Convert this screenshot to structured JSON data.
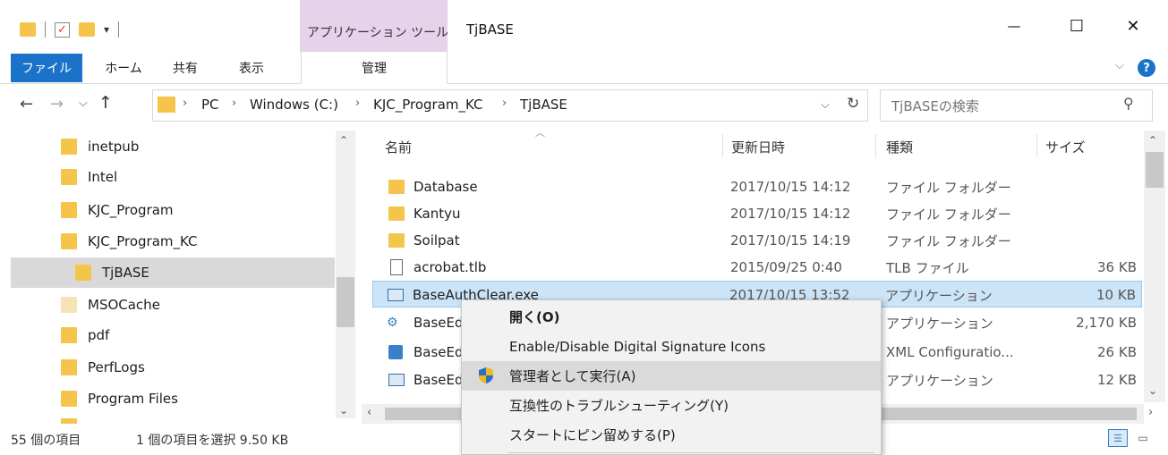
{
  "titlebar": {
    "context_tab_label": "アプリケーション ツール",
    "window_title": "TjBASE",
    "minimize_label": "—",
    "maximize_label": "☐",
    "close_label": "✕"
  },
  "ribbon": {
    "tabs": [
      "ファイル",
      "ホーム",
      "共有",
      "表示",
      "管理"
    ],
    "expand_label": "⌵",
    "help_label": "?"
  },
  "address": {
    "back_label": "←",
    "forward_label": "→",
    "recent_label": "⌵",
    "up_label": "↑",
    "path": [
      "PC",
      "Windows (C:)",
      "KJC_Program_KC",
      "TjBASE"
    ],
    "dropdown_label": "⌵",
    "refresh_label": "↻",
    "search_placeholder": "TjBASEの検索",
    "search_icon_label": "⚲"
  },
  "nav": {
    "items": [
      {
        "label": "inetpub",
        "faded": false
      },
      {
        "label": "Intel",
        "faded": false
      },
      {
        "label": "KJC_Program",
        "faded": false
      },
      {
        "label": "KJC_Program_KC",
        "faded": false
      },
      {
        "label": "TjBASE",
        "faded": false
      },
      {
        "label": "MSOCache",
        "faded": true
      },
      {
        "label": "pdf",
        "faded": false
      },
      {
        "label": "PerfLogs",
        "faded": false
      },
      {
        "label": "Program Files",
        "faded": false
      }
    ],
    "selected_index": 4
  },
  "columns": {
    "name": "名前",
    "date": "更新日時",
    "type": "種類",
    "size": "サイズ"
  },
  "files": [
    {
      "name": "Database",
      "date": "2017/10/15 14:12",
      "type": "ファイル フォルダー",
      "size": "",
      "icon": "folder"
    },
    {
      "name": "Kantyu",
      "date": "2017/10/15 14:12",
      "type": "ファイル フォルダー",
      "size": "",
      "icon": "folder"
    },
    {
      "name": "Soilpat",
      "date": "2017/10/15 14:19",
      "type": "ファイル フォルダー",
      "size": "",
      "icon": "folder"
    },
    {
      "name": "acrobat.tlb",
      "date": "2015/09/25 0:40",
      "type": "TLB ファイル",
      "size": "36 KB",
      "icon": "doc"
    },
    {
      "name": "BaseAuthClear.exe",
      "date": "2017/10/15 13:52",
      "type": "アプリケーション",
      "size": "10 KB",
      "icon": "app"
    },
    {
      "name": "BaseEd",
      "date": "",
      "type": "アプリケーション",
      "size": "2,170 KB",
      "icon": "app-alt"
    },
    {
      "name": "BaseEd",
      "date": "",
      "type": "XML Configuratio...",
      "size": "26 KB",
      "icon": "xml"
    },
    {
      "name": "BaseEd",
      "date": "",
      "type": "アプリケーション",
      "size": "12 KB",
      "icon": "app"
    }
  ],
  "selected_file_index": 4,
  "context_menu": {
    "items": [
      {
        "label": "開く(O)",
        "bold": true
      },
      {
        "label": "Enable/Disable Digital Signature Icons",
        "bold": false
      },
      {
        "label": "管理者として実行(A)",
        "bold": false
      },
      {
        "label": "互換性のトラブルシューティング(Y)",
        "bold": false
      },
      {
        "label": "スタートにピン留めする(P)",
        "bold": false
      }
    ],
    "highlighted_index": 2
  },
  "status": {
    "item_count": "55 個の項目",
    "selection": "1 個の項目を選択  9.50 KB"
  },
  "colors": {
    "accent": "#1a73c8",
    "selection": "#cce4f7",
    "context_tab": "#e6d2ea",
    "folder": "#f4c54a"
  }
}
